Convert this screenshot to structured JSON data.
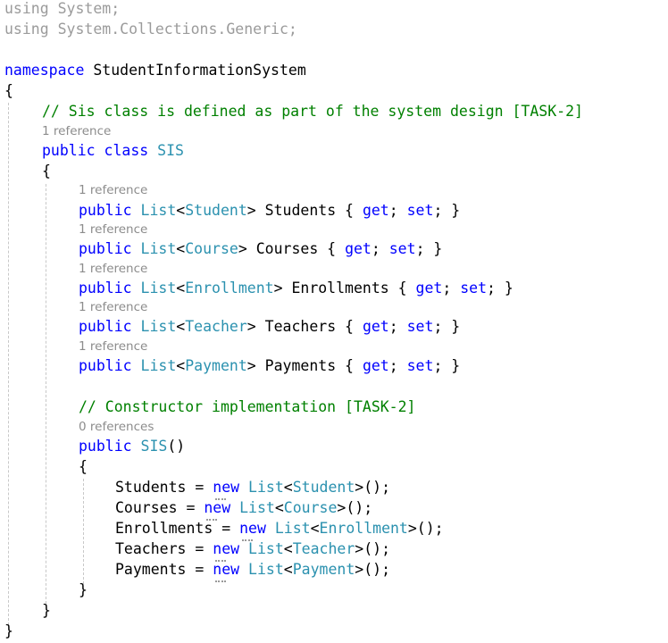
{
  "colors": {
    "keyword": "#0000ff",
    "type": "#2b91af",
    "comment": "#008000",
    "codelens": "#8c8c8c"
  },
  "code": {
    "using1": {
      "kw": "using",
      "rest": " System;"
    },
    "using2": {
      "kw": "using",
      "rest": " System.Collections.Generic;"
    },
    "ns": {
      "kw": "namespace",
      "name": " StudentInformationSystem"
    },
    "brace_open": "{",
    "brace_close": "}",
    "comment_class": "// Sis class is defined as part of the system design [TASK-2]",
    "lens_class": "1 reference",
    "class_decl": {
      "kw1": "public",
      "kw2": "class",
      "name": "SIS"
    },
    "props": [
      {
        "lens": "1 reference",
        "kw": "public",
        "generic": "List",
        "type": "Student",
        "name": " Students { ",
        "get": "get",
        "set": "set",
        "end": "; }"
      },
      {
        "lens": "1 reference",
        "kw": "public",
        "generic": "List",
        "type": "Course",
        "name": " Courses { ",
        "get": "get",
        "set": "set",
        "end": "; }"
      },
      {
        "lens": "1 reference",
        "kw": "public",
        "generic": "List",
        "type": "Enrollment",
        "name": " Enrollments { ",
        "get": "get",
        "set": "set",
        "end": "; }"
      },
      {
        "lens": "1 reference",
        "kw": "public",
        "generic": "List",
        "type": "Teacher",
        "name": " Teachers { ",
        "get": "get",
        "set": "set",
        "end": "; }"
      },
      {
        "lens": "1 reference",
        "kw": "public",
        "generic": "List",
        "type": "Payment",
        "name": " Payments { ",
        "get": "get",
        "set": "set",
        "end": "; }"
      }
    ],
    "comment_ctor": "// Constructor implementation [TASK-2]",
    "lens_ctor": "0 references",
    "ctor": {
      "kw": "public",
      "name": "SIS",
      "parens": "()"
    },
    "assigns": [
      {
        "target": "Students",
        "op": " = ",
        "kw": "new",
        "generic": "List",
        "type": "Student",
        "tail": ">();"
      },
      {
        "target": "Courses",
        "op": " = ",
        "kw": "new",
        "generic": "List",
        "type": "Course",
        "tail": ">();"
      },
      {
        "target": "Enrollments",
        "op": " = ",
        "kw": "new",
        "generic": "List",
        "type": "Enrollment",
        "tail": ">();"
      },
      {
        "target": "Teachers",
        "op": " = ",
        "kw": "new",
        "generic": "List",
        "type": "Teacher",
        "tail": ">();"
      },
      {
        "target": "Payments",
        "op": " = ",
        "kw": "new",
        "generic": "List",
        "type": "Payment",
        "tail": ">();"
      }
    ]
  }
}
